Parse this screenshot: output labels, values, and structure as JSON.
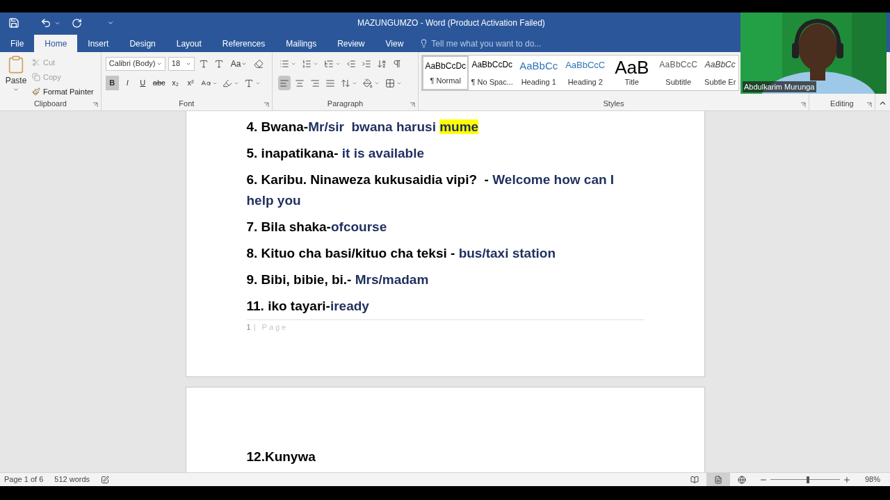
{
  "window": {
    "title": "MAZUNGUMZO - Word (Product Activation Failed)"
  },
  "tabs": [
    {
      "label": "File",
      "selected": false
    },
    {
      "label": "Home",
      "selected": true
    },
    {
      "label": "Insert",
      "selected": false
    },
    {
      "label": "Design",
      "selected": false
    },
    {
      "label": "Layout",
      "selected": false
    },
    {
      "label": "References",
      "selected": false
    },
    {
      "label": "Mailings",
      "selected": false
    },
    {
      "label": "Review",
      "selected": false
    },
    {
      "label": "View",
      "selected": false
    }
  ],
  "tell_me": {
    "placeholder": "Tell me what you want to do..."
  },
  "clipboard": {
    "label": "Clipboard",
    "paste": "Paste",
    "items": [
      {
        "label": "Cut",
        "disabled": true
      },
      {
        "label": "Copy",
        "disabled": true
      },
      {
        "label": "Format Painter",
        "disabled": false
      }
    ]
  },
  "font": {
    "label": "Font",
    "name": "Calibri (Body)",
    "size": "18",
    "change_case": "Aa",
    "format_buttons": [
      {
        "label": "B",
        "selected": true
      },
      {
        "label": "I",
        "selected": false
      },
      {
        "label": "U",
        "selected": false
      },
      {
        "label": "abc",
        "selected": false
      },
      {
        "label": "x₂",
        "selected": false
      },
      {
        "label": "x²",
        "selected": false
      }
    ]
  },
  "paragraph": {
    "label": "Paragraph",
    "alignment": [
      {
        "selected": true
      },
      {
        "selected": false
      },
      {
        "selected": false
      },
      {
        "selected": false
      }
    ]
  },
  "styles": {
    "label": "Styles",
    "items": [
      {
        "sample": "AaBbCcDc",
        "name": "¶ Normal",
        "selected": true,
        "kind": "body"
      },
      {
        "sample": "AaBbCcDc",
        "name": "¶ No Spac...",
        "selected": false,
        "kind": "body"
      },
      {
        "sample": "AaBbCc",
        "name": "Heading 1",
        "selected": false,
        "kind": "heading1"
      },
      {
        "sample": "AaBbCcC",
        "name": "Heading 2",
        "selected": false,
        "kind": "heading2"
      },
      {
        "sample": "AaB",
        "name": "Title",
        "selected": false,
        "kind": "title"
      },
      {
        "sample": "AaBbCcC",
        "name": "Subtitle",
        "selected": false,
        "kind": "subtitle"
      },
      {
        "sample": "AaBbCc",
        "name": "Subtle Er",
        "selected": false,
        "kind": "emphasis"
      }
    ]
  },
  "editing": {
    "label": "Editing"
  },
  "video": {
    "kind": "picture",
    "name": "Abdulkarim Murunga"
  },
  "pages": [
    {
      "lines": [
        [
          {
            "text": "4. Bwana-",
            "kind": "plain"
          },
          {
            "text": "Mr/sir  bwana harusi ",
            "kind": "english"
          },
          {
            "text": "mume",
            "kind": "highlight"
          }
        ],
        [
          {
            "text": "5. inapatikana- ",
            "kind": "plain"
          },
          {
            "text": "it is available",
            "kind": "english"
          }
        ],
        [
          {
            "text": "6. Karibu. Ninaweza kukusaidia vipi?  - ",
            "kind": "plain"
          },
          {
            "text": "Welcome how can I help you",
            "kind": "english"
          }
        ],
        [
          {
            "text": "7. Bila shaka-",
            "kind": "plain"
          },
          {
            "text": "ofcourse",
            "kind": "english"
          }
        ],
        [
          {
            "text": "8. Kituo cha basi/kituo cha teksi - ",
            "kind": "plain"
          },
          {
            "text": "bus/taxi station",
            "kind": "english"
          }
        ],
        [
          {
            "text": "9. Bibi, bibie, bi.- ",
            "kind": "plain"
          },
          {
            "text": "Mrs/madam",
            "kind": "english"
          }
        ],
        [
          {
            "text": "11. iko tayari-",
            "kind": "plain"
          },
          {
            "text": "iready",
            "kind": "english"
          }
        ]
      ],
      "footer": {
        "number": "1",
        "text": "| Page"
      }
    },
    {
      "lines": [
        [
          {
            "text": "12.Kunywa",
            "kind": "plain"
          }
        ]
      ]
    }
  ],
  "status_bar": {
    "page": "Page 1 of 6",
    "words": "512 words",
    "views": [
      {
        "selected": false,
        "kind": "read"
      },
      {
        "selected": true,
        "kind": "print"
      },
      {
        "selected": false,
        "kind": "web"
      }
    ],
    "zoom": {
      "level": 0.52,
      "reading": "98%"
    }
  }
}
